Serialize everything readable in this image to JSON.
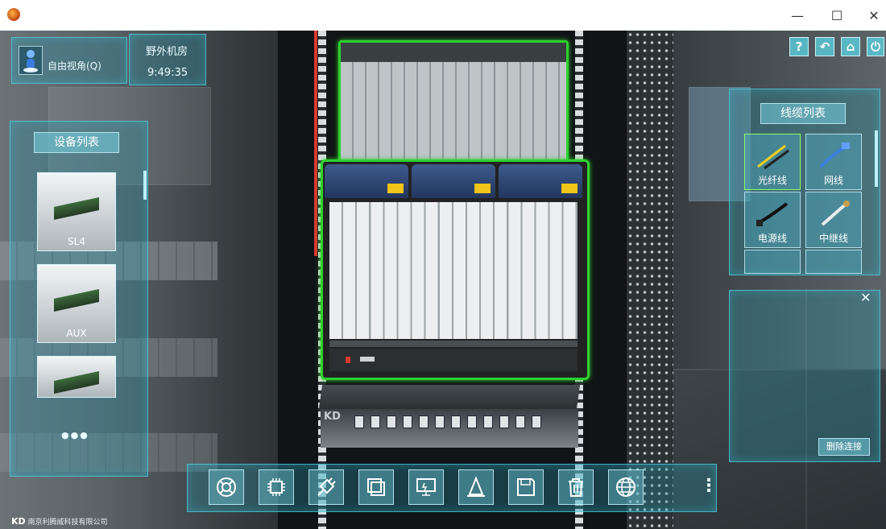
{
  "window": {
    "minimize_glyph": "—",
    "maximize_glyph": "☐",
    "close_glyph": "✕"
  },
  "camera": {
    "mode_label": "自由视角(Q)"
  },
  "location": {
    "room_name": "野外机房",
    "clock": "9:49:35"
  },
  "device_list": {
    "title": "设备列表",
    "items": [
      {
        "label": "SL4"
      },
      {
        "label": "AUX"
      },
      {
        "label": ""
      }
    ],
    "more_glyph": "●●●"
  },
  "cable_list": {
    "title": "线缆列表",
    "items": [
      {
        "label": "光纤线",
        "selected": true
      },
      {
        "label": "网线",
        "selected": false
      },
      {
        "label": "电源线",
        "selected": false
      },
      {
        "label": "中继线",
        "selected": false
      },
      {
        "label": "",
        "selected": false
      },
      {
        "label": "",
        "selected": false
      }
    ]
  },
  "connection_panel": {
    "delete_button": "删除连接",
    "close_glyph": "✕"
  },
  "corner_toolbar": [
    {
      "icon": "help-icon",
      "glyph": "?"
    },
    {
      "icon": "undo-icon",
      "glyph": "↶"
    },
    {
      "icon": "home-icon",
      "glyph": "⌂"
    },
    {
      "icon": "power-icon",
      "glyph": "⏻"
    }
  ],
  "bottom_toolbar": {
    "buttons": [
      {
        "icon": "lifebuoy-icon"
      },
      {
        "icon": "chip-icon"
      },
      {
        "icon": "plug-icon"
      },
      {
        "icon": "layers-icon"
      },
      {
        "icon": "monitor-icon"
      },
      {
        "icon": "cone-icon"
      },
      {
        "icon": "save-icon"
      },
      {
        "icon": "trash-icon"
      },
      {
        "icon": "globe-icon"
      }
    ],
    "more_glyph": "⋮"
  },
  "company": {
    "logo_text": "KD",
    "name": "南京利腾威科技有限公司"
  },
  "rack": {
    "odf_mark": "KD"
  },
  "colors": {
    "accent": "#4fd3e6",
    "highlight": "#2fd12f",
    "cable_red": "#d83a2e"
  }
}
